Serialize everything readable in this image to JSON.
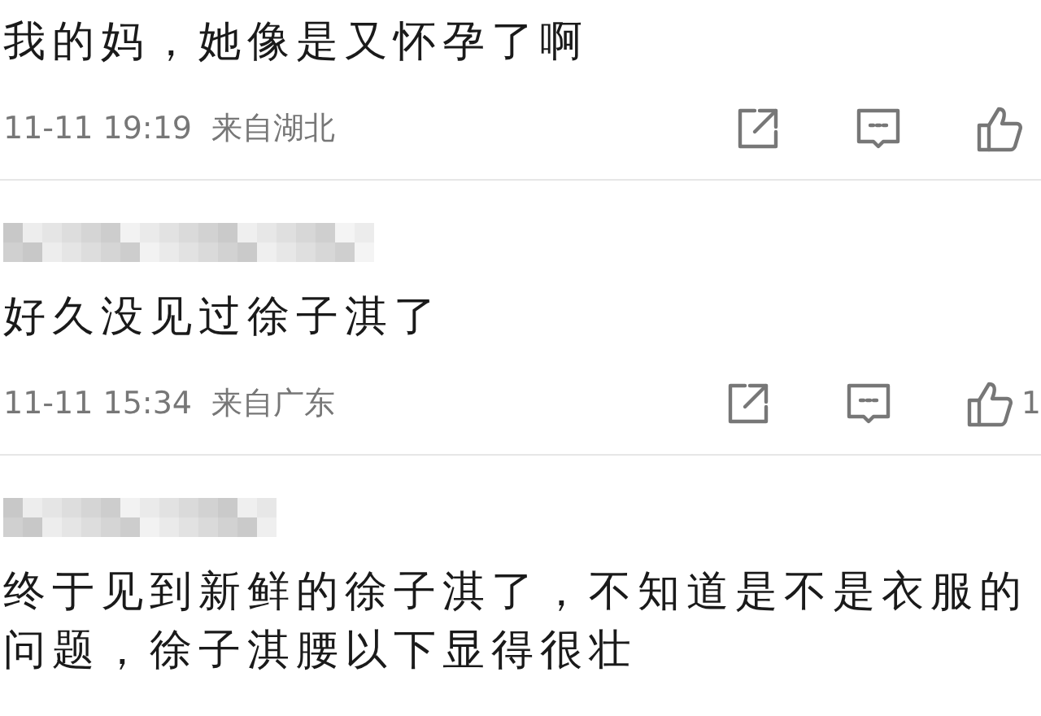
{
  "comments": [
    {
      "author_visible": false,
      "text": "我的妈，她像是又怀孕了啊",
      "time": "11-11 19:19",
      "location": "来自湖北"
    },
    {
      "author_visible": true,
      "text": "好久没见过徐子淇了",
      "time": "11-11 15:34",
      "location": "来自广东",
      "likes": "1"
    },
    {
      "author_visible": true,
      "text": "终于见到新鲜的徐子淇了，不知道是不是衣服的问题，徐子淇腰以下显得很壮"
    }
  ]
}
